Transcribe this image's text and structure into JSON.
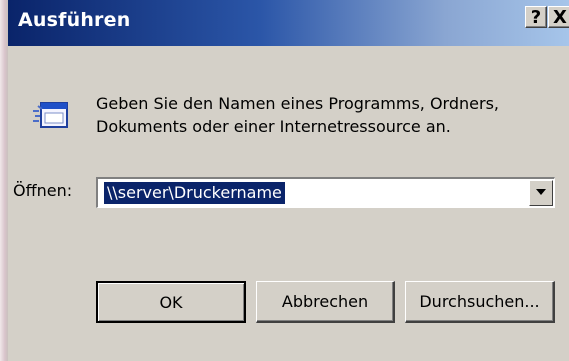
{
  "window": {
    "title": "Ausführen",
    "help_label": "?",
    "close_label": "X"
  },
  "icon": "run-dialog-icon",
  "message": {
    "line1": "Geben Sie den Namen eines Programms, Ordners,",
    "line2": "Dokuments oder einer Internetressource an."
  },
  "open_field": {
    "label": "Öffnen:",
    "value": "\\\\server\\Druckername"
  },
  "buttons": {
    "ok_label": "OK",
    "cancel_label": "Abbrechen",
    "browse_label": "Durchsuchen..."
  },
  "colors": {
    "title_gradient_start": "#0a246a",
    "title_gradient_end": "#a6c5ea",
    "dialog_face": "#d4d0c8",
    "selection": "#0a246a"
  }
}
